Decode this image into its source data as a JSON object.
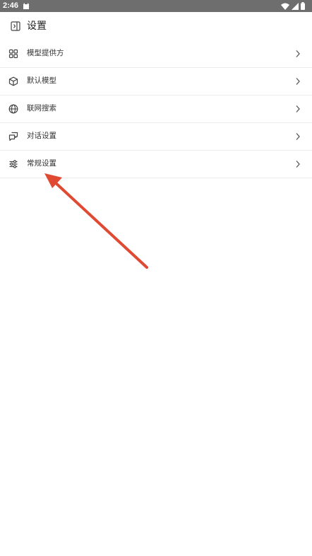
{
  "status_bar": {
    "time": "2:46"
  },
  "header": {
    "title": "设置",
    "toggle_icon": "sidebar-toggle-icon"
  },
  "settings": {
    "items": [
      {
        "label": "模型提供方",
        "icon": "grid-icon"
      },
      {
        "label": "默认模型",
        "icon": "cube-icon"
      },
      {
        "label": "联网搜索",
        "icon": "globe-icon"
      },
      {
        "label": "对话设置",
        "icon": "chat-bubbles-icon"
      },
      {
        "label": "常规设置",
        "icon": "sliders-icon"
      }
    ]
  },
  "colors": {
    "status_bar_bg": "#6e6e6e",
    "annotation_arrow": "#e04a32",
    "divider": "#ececec"
  }
}
